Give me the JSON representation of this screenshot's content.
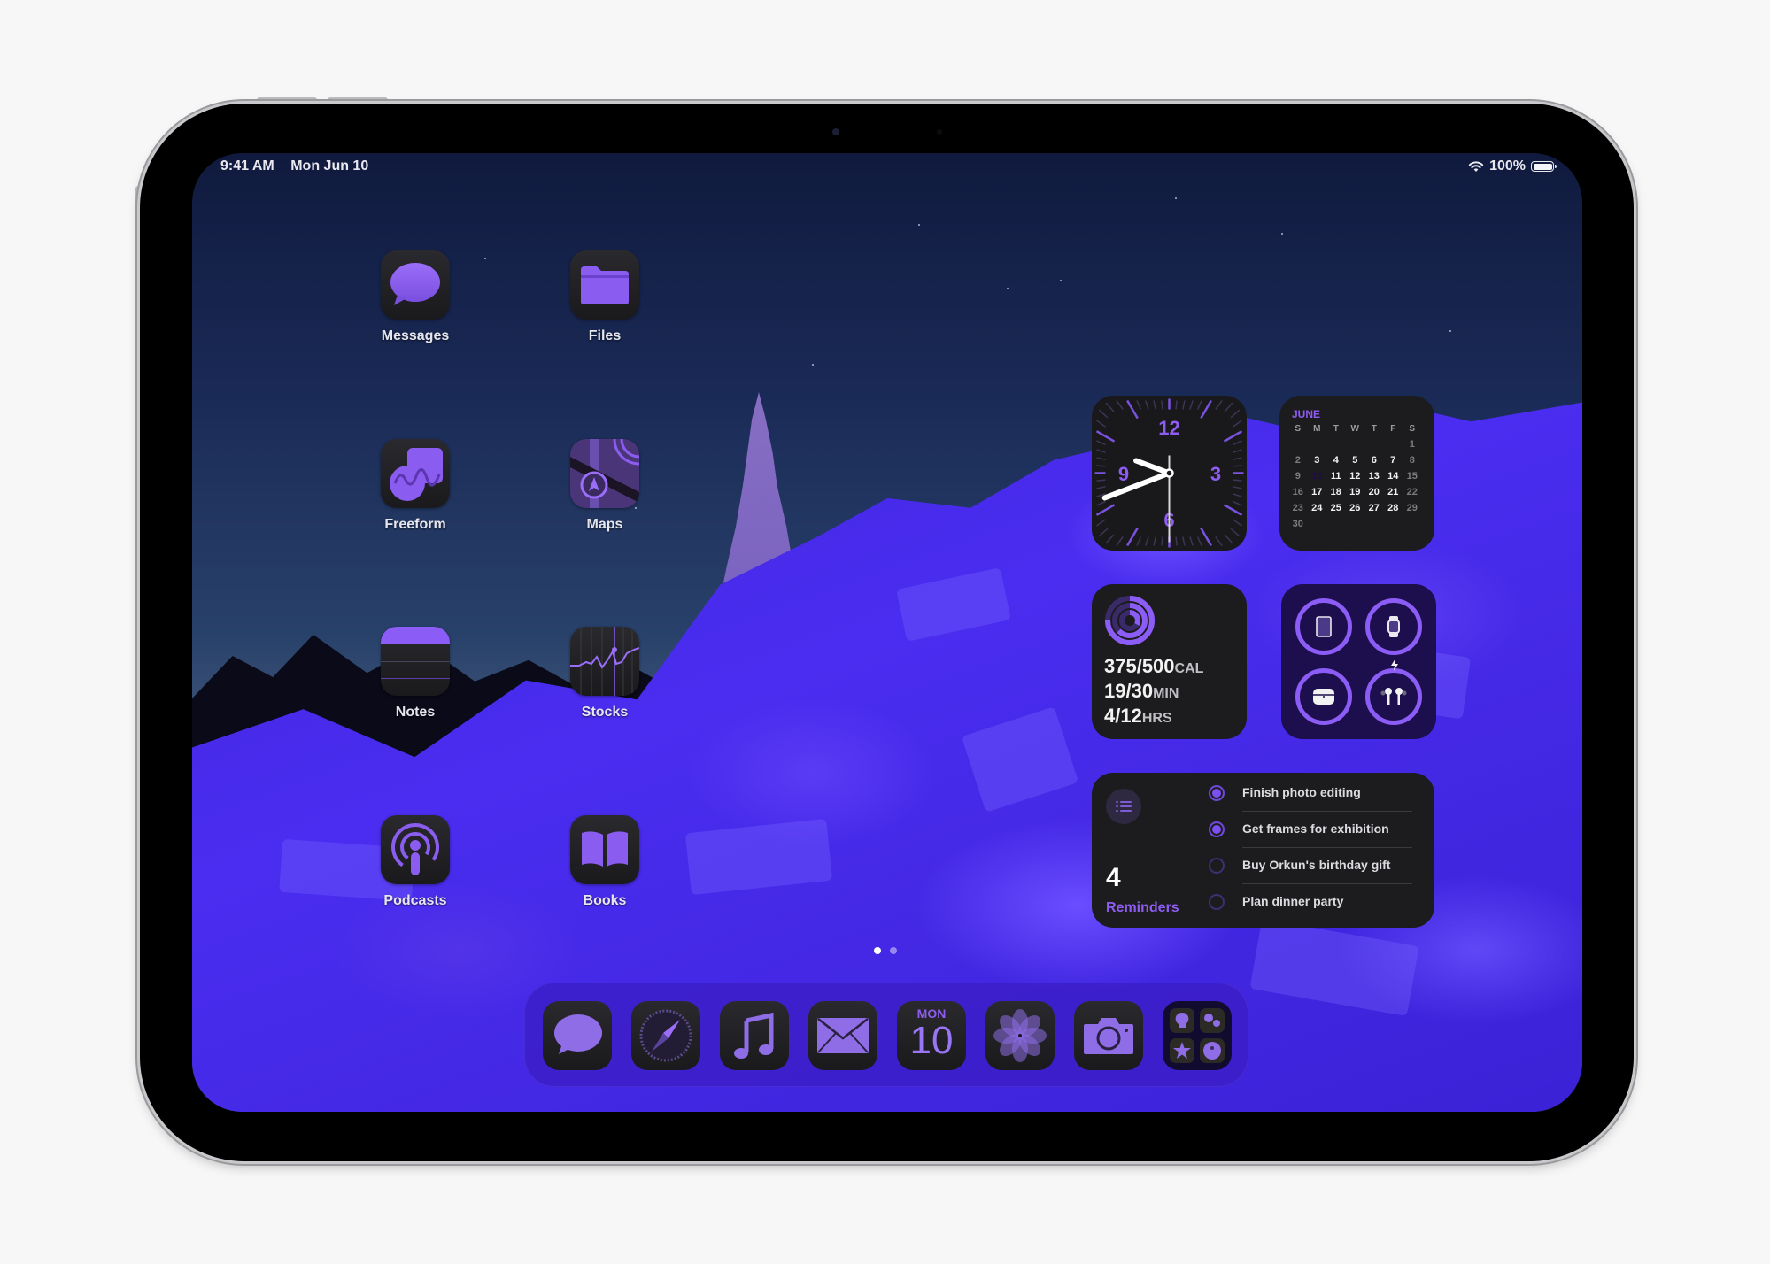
{
  "status_bar": {
    "time": "9:41 AM",
    "date": "Mon Jun 10",
    "battery": "100%",
    "wifi_icon": "wifi-icon",
    "battery_icon": "battery-full-icon"
  },
  "home_apps": [
    {
      "label": "Messages",
      "icon": "messages-icon"
    },
    {
      "label": "Files",
      "icon": "files-icon"
    },
    {
      "label": "Freeform",
      "icon": "freeform-icon"
    },
    {
      "label": "Maps",
      "icon": "maps-icon"
    },
    {
      "label": "Notes",
      "icon": "notes-icon"
    },
    {
      "label": "Stocks",
      "icon": "stocks-icon"
    },
    {
      "label": "Podcasts",
      "icon": "podcasts-icon"
    },
    {
      "label": "Books",
      "icon": "books-icon"
    }
  ],
  "clock_widget": {
    "numerals": [
      "12",
      "3",
      "6",
      "9"
    ],
    "time": {
      "hour": 9,
      "minute": 41,
      "second": 30
    }
  },
  "calendar_widget": {
    "month": "JUNE",
    "weekdays": [
      "S",
      "M",
      "T",
      "W",
      "T",
      "F",
      "S"
    ],
    "first_weekday_index": 6,
    "days_in_month": 30,
    "today": 10
  },
  "activity_widget": {
    "move": {
      "value": "375/500",
      "unit": "CAL",
      "progress": 0.75
    },
    "exercise": {
      "value": "19/30",
      "unit": "MIN",
      "progress": 0.63
    },
    "stand": {
      "value": "4/12",
      "unit": "HRS",
      "progress": 0.33
    }
  },
  "batteries_widget": {
    "devices": [
      {
        "name": "iPad",
        "icon": "ipad-icon",
        "level": 1.0,
        "charging": false
      },
      {
        "name": "Apple Watch",
        "icon": "watch-icon",
        "level": 1.0,
        "charging": false
      },
      {
        "name": "AirPods Case",
        "icon": "airpods-case-icon",
        "level": 1.0,
        "charging": false
      },
      {
        "name": "AirPods",
        "icon": "airpods-icon",
        "level": 1.0,
        "charging": true
      }
    ]
  },
  "reminders_widget": {
    "count": "4",
    "label": "Reminders",
    "items": [
      {
        "text": "Finish photo editing",
        "done": true
      },
      {
        "text": "Get frames for exhibition",
        "done": true
      },
      {
        "text": "Buy Orkun's birthday gift",
        "done": false
      },
      {
        "text": "Plan dinner party",
        "done": false
      }
    ]
  },
  "page_indicator": {
    "pages": 2,
    "current": 1
  },
  "dock": {
    "apps": [
      {
        "name": "Messages",
        "icon": "messages-icon"
      },
      {
        "name": "Safari",
        "icon": "safari-icon"
      },
      {
        "name": "Music",
        "icon": "music-icon"
      },
      {
        "name": "Mail",
        "icon": "mail-icon"
      },
      {
        "name": "Calendar",
        "icon": "calendar-icon",
        "day": "MON",
        "date": "10"
      },
      {
        "name": "Photos",
        "icon": "photos-icon"
      },
      {
        "name": "Camera",
        "icon": "camera-icon"
      },
      {
        "name": "Folder",
        "icon": "app-folder-icon"
      }
    ]
  },
  "colors": {
    "accent": "#8b5cf6",
    "widget_bg": "#1c1c1e",
    "battery_widget_bg": "#1d0f4d",
    "dock_bg": "#3c1ec8"
  }
}
